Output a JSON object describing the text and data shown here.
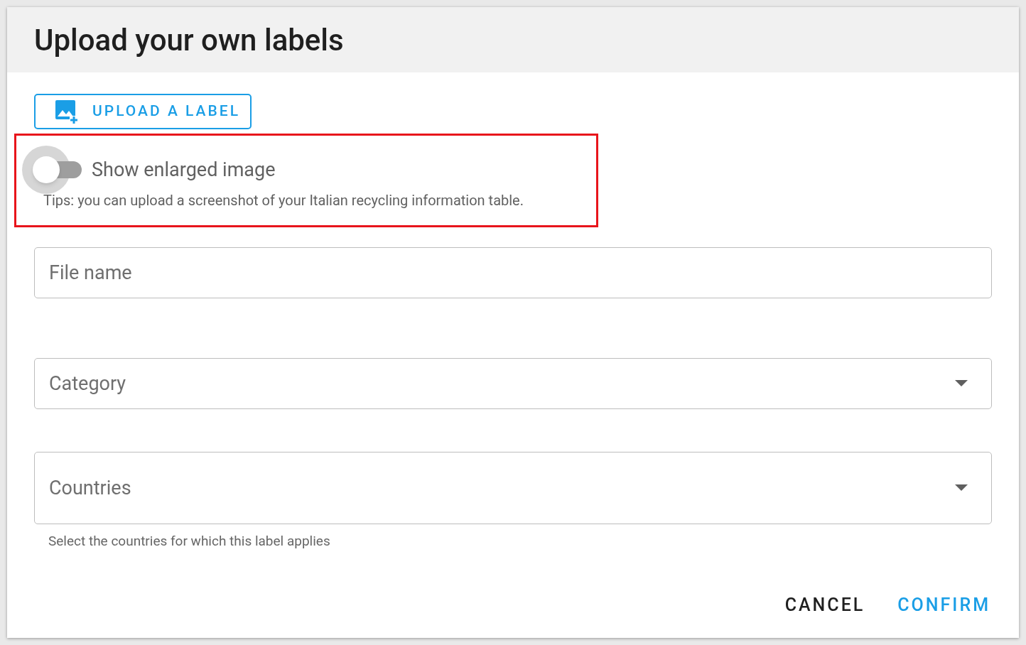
{
  "dialog": {
    "title": "Upload your own labels",
    "upload_button": {
      "label": "UPLOAD A LABEL"
    },
    "highlight": {
      "toggle": {
        "label": "Show enlarged image",
        "on": false
      },
      "tip": "Tips: you can upload a screenshot of your Italian recycling information table."
    },
    "fields": [
      {
        "kind": "text",
        "placeholder": "File name"
      },
      {
        "kind": "select",
        "placeholder": "Category"
      },
      {
        "kind": "multiselect",
        "placeholder": "Countries",
        "helper": "Select the countries for which this label applies"
      }
    ],
    "actions": [
      {
        "label": "CANCEL",
        "kind": "secondary"
      },
      {
        "label": "CONFIRM",
        "kind": "primary"
      }
    ]
  }
}
